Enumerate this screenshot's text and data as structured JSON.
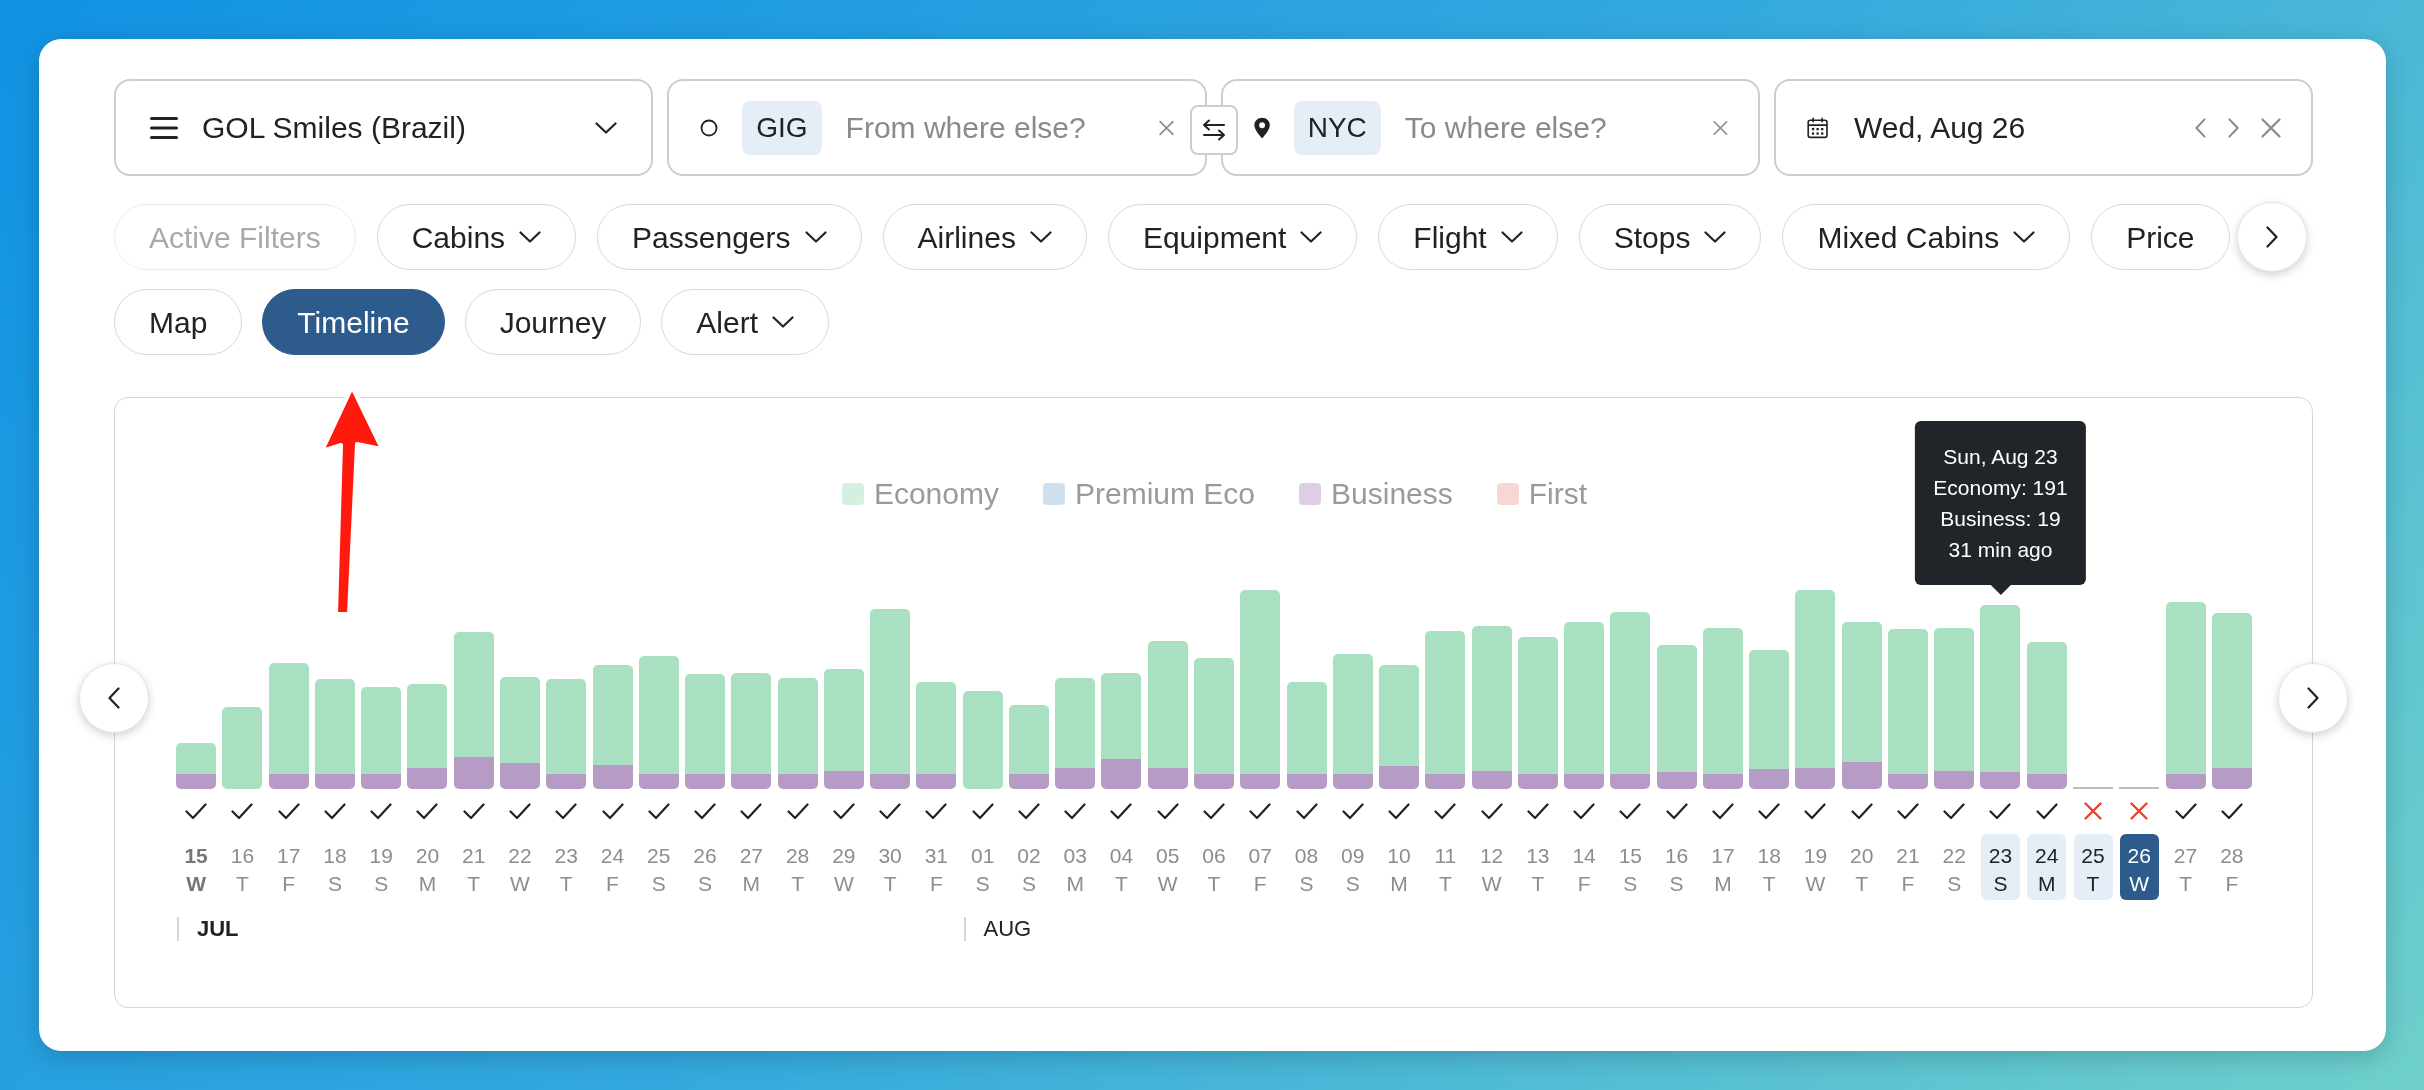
{
  "program_select": {
    "label": "GOL Smiles (Brazil)"
  },
  "origin": {
    "code": "GIG",
    "placeholder": "From where else?"
  },
  "destination": {
    "code": "NYC",
    "placeholder": "To where else?"
  },
  "date": {
    "value": "Wed, Aug 26"
  },
  "filters": [
    {
      "label": "Active Filters",
      "dropdown": false,
      "disabled": true
    },
    {
      "label": "Cabins",
      "dropdown": true,
      "disabled": false
    },
    {
      "label": "Passengers",
      "dropdown": true,
      "disabled": false
    },
    {
      "label": "Airlines",
      "dropdown": true,
      "disabled": false
    },
    {
      "label": "Equipment",
      "dropdown": true,
      "disabled": false
    },
    {
      "label": "Flight",
      "dropdown": true,
      "disabled": false
    },
    {
      "label": "Stops",
      "dropdown": true,
      "disabled": false
    },
    {
      "label": "Mixed Cabins",
      "dropdown": true,
      "disabled": false
    },
    {
      "label": "Price",
      "dropdown": false,
      "disabled": false
    }
  ],
  "views": [
    {
      "label": "Map",
      "selected": false,
      "dropdown": false
    },
    {
      "label": "Timeline",
      "selected": true,
      "dropdown": false
    },
    {
      "label": "Journey",
      "selected": false,
      "dropdown": false
    },
    {
      "label": "Alert",
      "selected": false,
      "dropdown": true
    }
  ],
  "chart": {
    "legend": [
      {
        "label": "Economy",
        "color": "#d4f0e0"
      },
      {
        "label": "Premium Eco",
        "color": "#cfe1ee"
      },
      {
        "label": "Business",
        "color": "#ddcde5"
      },
      {
        "label": "First",
        "color": "#f6d7d6"
      }
    ],
    "tooltip": {
      "lines": [
        "Sun, Aug 23",
        "Economy: 191",
        "Business: 19",
        "31 min ago"
      ]
    },
    "months": [
      {
        "label": "JUL",
        "current": true,
        "days": [
          {
            "date": "15",
            "weekday": "W",
            "available": true,
            "today": true,
            "in_range": false,
            "selected": false,
            "hovered": false
          },
          {
            "date": "16",
            "weekday": "T",
            "available": true,
            "today": false,
            "in_range": false,
            "selected": false,
            "hovered": false
          },
          {
            "date": "17",
            "weekday": "F",
            "available": true,
            "today": false,
            "in_range": false,
            "selected": false,
            "hovered": false
          },
          {
            "date": "18",
            "weekday": "S",
            "available": true,
            "today": false,
            "in_range": false,
            "selected": false,
            "hovered": false
          },
          {
            "date": "19",
            "weekday": "S",
            "available": true,
            "today": false,
            "in_range": false,
            "selected": false,
            "hovered": false
          },
          {
            "date": "20",
            "weekday": "M",
            "available": true,
            "today": false,
            "in_range": false,
            "selected": false,
            "hovered": false
          },
          {
            "date": "21",
            "weekday": "T",
            "available": true,
            "today": false,
            "in_range": false,
            "selected": false,
            "hovered": false
          },
          {
            "date": "22",
            "weekday": "W",
            "available": true,
            "today": false,
            "in_range": false,
            "selected": false,
            "hovered": false
          },
          {
            "date": "23",
            "weekday": "T",
            "available": true,
            "today": false,
            "in_range": false,
            "selected": false,
            "hovered": false
          },
          {
            "date": "24",
            "weekday": "F",
            "available": true,
            "today": false,
            "in_range": false,
            "selected": false,
            "hovered": false
          },
          {
            "date": "25",
            "weekday": "S",
            "available": true,
            "today": false,
            "in_range": false,
            "selected": false,
            "hovered": false
          },
          {
            "date": "26",
            "weekday": "S",
            "available": true,
            "today": false,
            "in_range": false,
            "selected": false,
            "hovered": false
          },
          {
            "date": "27",
            "weekday": "M",
            "available": true,
            "today": false,
            "in_range": false,
            "selected": false,
            "hovered": false
          },
          {
            "date": "28",
            "weekday": "T",
            "available": true,
            "today": false,
            "in_range": false,
            "selected": false,
            "hovered": false
          },
          {
            "date": "29",
            "weekday": "W",
            "available": true,
            "today": false,
            "in_range": false,
            "selected": false,
            "hovered": false
          },
          {
            "date": "30",
            "weekday": "T",
            "available": true,
            "today": false,
            "in_range": false,
            "selected": false,
            "hovered": false
          },
          {
            "date": "31",
            "weekday": "F",
            "available": true,
            "today": false,
            "in_range": false,
            "selected": false,
            "hovered": false
          }
        ]
      },
      {
        "label": "AUG",
        "current": false,
        "days": [
          {
            "date": "01",
            "weekday": "S",
            "available": true,
            "today": false,
            "in_range": false,
            "selected": false,
            "hovered": false
          },
          {
            "date": "02",
            "weekday": "S",
            "available": true,
            "today": false,
            "in_range": false,
            "selected": false,
            "hovered": false
          },
          {
            "date": "03",
            "weekday": "M",
            "available": true,
            "today": false,
            "in_range": false,
            "selected": false,
            "hovered": false
          },
          {
            "date": "04",
            "weekday": "T",
            "available": true,
            "today": false,
            "in_range": false,
            "selected": false,
            "hovered": false
          },
          {
            "date": "05",
            "weekday": "W",
            "available": true,
            "today": false,
            "in_range": false,
            "selected": false,
            "hovered": false
          },
          {
            "date": "06",
            "weekday": "T",
            "available": true,
            "today": false,
            "in_range": false,
            "selected": false,
            "hovered": false
          },
          {
            "date": "07",
            "weekday": "F",
            "available": true,
            "today": false,
            "in_range": false,
            "selected": false,
            "hovered": false
          },
          {
            "date": "08",
            "weekday": "S",
            "available": true,
            "today": false,
            "in_range": false,
            "selected": false,
            "hovered": false
          },
          {
            "date": "09",
            "weekday": "S",
            "available": true,
            "today": false,
            "in_range": false,
            "selected": false,
            "hovered": false
          },
          {
            "date": "10",
            "weekday": "M",
            "available": true,
            "today": false,
            "in_range": false,
            "selected": false,
            "hovered": false
          },
          {
            "date": "11",
            "weekday": "T",
            "available": true,
            "today": false,
            "in_range": false,
            "selected": false,
            "hovered": false
          },
          {
            "date": "12",
            "weekday": "W",
            "available": true,
            "today": false,
            "in_range": false,
            "selected": false,
            "hovered": false
          },
          {
            "date": "13",
            "weekday": "T",
            "available": true,
            "today": false,
            "in_range": false,
            "selected": false,
            "hovered": false
          },
          {
            "date": "14",
            "weekday": "F",
            "available": true,
            "today": false,
            "in_range": false,
            "selected": false,
            "hovered": false
          },
          {
            "date": "15",
            "weekday": "S",
            "available": true,
            "today": false,
            "in_range": false,
            "selected": false,
            "hovered": false
          },
          {
            "date": "16",
            "weekday": "S",
            "available": true,
            "today": false,
            "in_range": false,
            "selected": false,
            "hovered": false
          },
          {
            "date": "17",
            "weekday": "M",
            "available": true,
            "today": false,
            "in_range": false,
            "selected": false,
            "hovered": false
          },
          {
            "date": "18",
            "weekday": "T",
            "available": true,
            "today": false,
            "in_range": false,
            "selected": false,
            "hovered": false
          },
          {
            "date": "19",
            "weekday": "W",
            "available": true,
            "today": false,
            "in_range": false,
            "selected": false,
            "hovered": false
          },
          {
            "date": "20",
            "weekday": "T",
            "available": true,
            "today": false,
            "in_range": false,
            "selected": false,
            "hovered": false
          },
          {
            "date": "21",
            "weekday": "F",
            "available": true,
            "today": false,
            "in_range": false,
            "selected": false,
            "hovered": false
          },
          {
            "date": "22",
            "weekday": "S",
            "available": true,
            "today": false,
            "in_range": false,
            "selected": false,
            "hovered": false
          },
          {
            "date": "23",
            "weekday": "S",
            "available": true,
            "today": false,
            "in_range": true,
            "selected": false,
            "hovered": true
          },
          {
            "date": "24",
            "weekday": "M",
            "available": true,
            "today": false,
            "in_range": true,
            "selected": false,
            "hovered": false
          },
          {
            "date": "25",
            "weekday": "T",
            "available": false,
            "today": false,
            "in_range": true,
            "selected": false,
            "hovered": false
          },
          {
            "date": "26",
            "weekday": "W",
            "available": false,
            "today": false,
            "in_range": false,
            "selected": true,
            "hovered": false
          },
          {
            "date": "27",
            "weekday": "T",
            "available": true,
            "today": false,
            "in_range": false,
            "selected": false,
            "hovered": false
          },
          {
            "date": "28",
            "weekday": "F",
            "available": true,
            "today": false,
            "in_range": false,
            "selected": false,
            "hovered": false
          }
        ]
      }
    ]
  },
  "annotations": [
    {
      "kind": "arrow"
    }
  ]
}
